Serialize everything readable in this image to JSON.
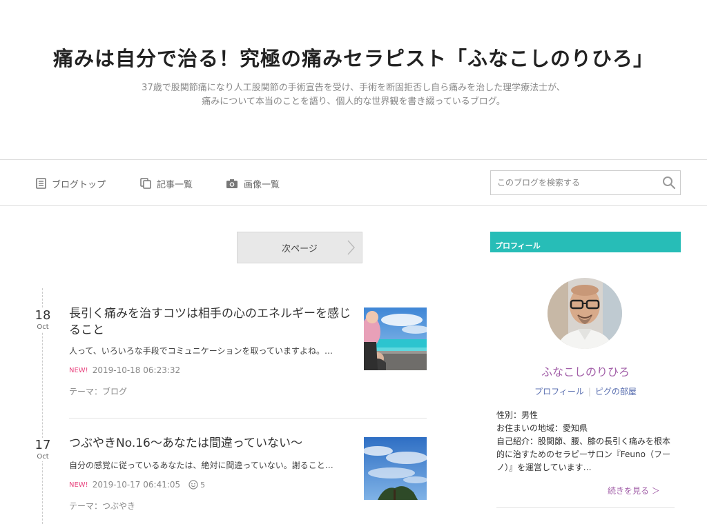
{
  "header": {
    "title": "痛みは自分で治る！究極の痛みセラピスト「ふなこしのりひろ」",
    "description_line1": "37歳で股関節痛になり人工股関節の手術宣告を受け、手術を断固拒否し自ら痛みを治した理学療法士が、",
    "description_line2": "痛みについて本当のことを語り、個人的な世界観を書き綴っているブログ。"
  },
  "nav": {
    "items": [
      {
        "label": "ブログトップ",
        "icon": "document-icon"
      },
      {
        "label": "記事一覧",
        "icon": "copy-icon"
      },
      {
        "label": "画像一覧",
        "icon": "camera-icon"
      }
    ],
    "search_placeholder": "このブログを検索する"
  },
  "pager": {
    "next_label": "次ページ"
  },
  "entries": [
    {
      "day": "18",
      "month": "Oct",
      "title": "長引く痛みを治すコツは相手の心のエネルギーを感じること",
      "excerpt": "人って、いろいろな手段でコミュニケーションを取っていますよね。…",
      "new_label": "NEW!",
      "datetime": "2019-10-18 06:23:32",
      "theme_prefix": "テーマ：",
      "theme": "ブログ"
    },
    {
      "day": "17",
      "month": "Oct",
      "title": "つぶやきNo.16〜あなたは間違っていない〜",
      "excerpt": "自分の感覚に従っているあなたは、絶対に間違っていない。謝ること…",
      "new_label": "NEW!",
      "datetime": "2019-10-17 06:41:05",
      "comments": "5",
      "theme_prefix": "テーマ：",
      "theme": "つぶやき"
    }
  ],
  "profile": {
    "header": "プロフィール",
    "name": "ふなこしのりひろ",
    "link_profile": "プロフィール",
    "link_room": "ピグの部屋",
    "gender": "性別：男性",
    "region": "お住まいの地域：愛知県",
    "intro": "自己紹介：股関節、腰、膝の長引く痛みを根本的に治すためのセラピーサロン『Feuno（フーノ）』を運営しています…",
    "more": "続きを見る ＞"
  },
  "colors": {
    "accent_teal": "#27bdb7",
    "profile_name": "#a25fa8",
    "link_blue": "#5a6fb0",
    "new_pink": "#e8437e"
  }
}
